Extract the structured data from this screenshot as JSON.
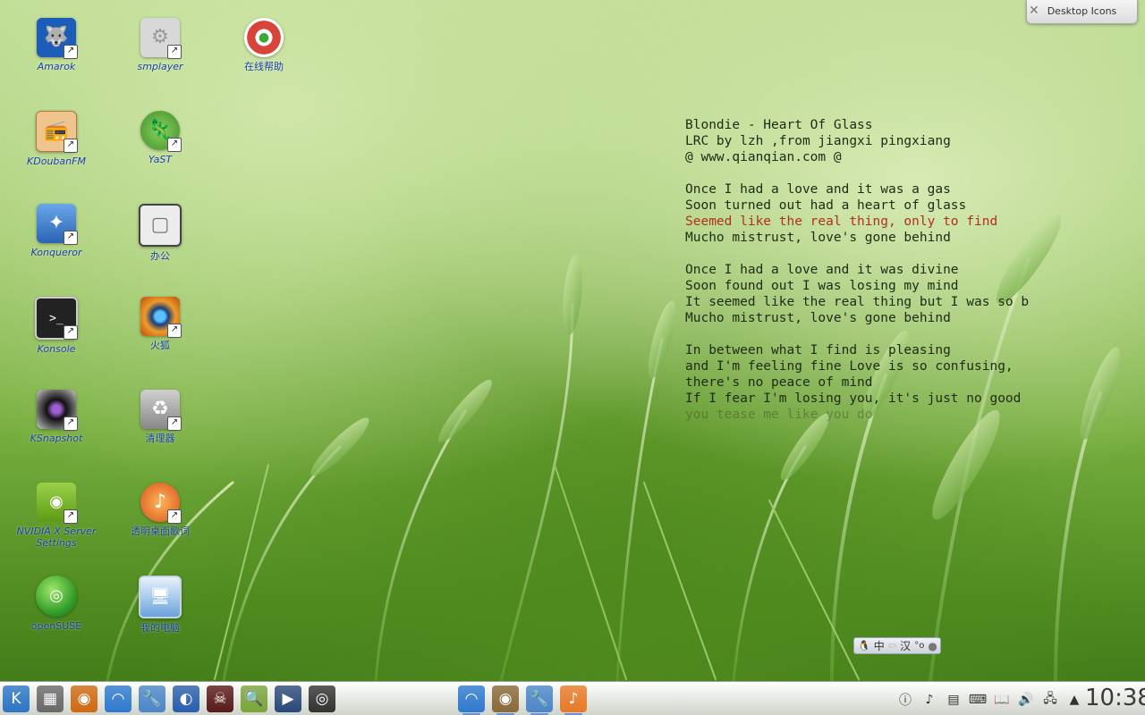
{
  "desktop": {
    "icons": [
      {
        "label": "Amarok",
        "glyph": "🐺",
        "icon": "amarok-icon",
        "bg": "#1b5db8"
      },
      {
        "label": "smplayer",
        "glyph": "⚙",
        "icon": "smplayer-icon",
        "bg": "#d8d8d8"
      },
      {
        "label": "在线帮助",
        "glyph": "🛟",
        "icon": "help-lifebuoy-icon",
        "bg": "#d8443a"
      },
      {
        "label": "KDoubanFM",
        "glyph": "📻",
        "icon": "radio-icon",
        "bg": "#e9b57a"
      },
      {
        "label": "YaST",
        "glyph": "🦎",
        "icon": "yast-icon",
        "bg": "#5aa83a"
      },
      {
        "label": "Konqueror",
        "glyph": "✦",
        "icon": "compass-icon",
        "bg": "#3d79c9"
      },
      {
        "label": "办公",
        "glyph": "▢",
        "icon": "document-icon",
        "bg": "#e8e8e8"
      },
      {
        "label": "Konsole",
        "glyph": ">_",
        "icon": "terminal-icon",
        "bg": "#2a2a2a"
      },
      {
        "label": "火狐",
        "glyph": "◉",
        "icon": "firefox-eye-icon",
        "bg": "#d06a12"
      },
      {
        "label": "KSnapshot",
        "glyph": "◎",
        "icon": "camera-lens-icon",
        "bg": "#3a3a3a"
      },
      {
        "label": "清理器",
        "glyph": "♻",
        "icon": "trash-bin-icon",
        "bg": "#8e8e8e"
      },
      {
        "label": "NVIDIA X Server Settings",
        "glyph": "◉",
        "icon": "nvidia-eye-icon",
        "bg": "#7ab51d"
      },
      {
        "label": "透明桌面歌词",
        "glyph": "♪",
        "icon": "lyrics-icon",
        "bg": "#e87a28"
      },
      {
        "label": "openSUSE",
        "glyph": "◎",
        "icon": "opensuse-icon",
        "bg": "#3aa836"
      },
      {
        "label": "我的电脑",
        "glyph": "🖥",
        "icon": "computer-icon",
        "bg": "#4a8cd1"
      }
    ]
  },
  "lyrics": {
    "lines": [
      "Blondie - Heart Of Glass",
      "LRC by lzh ,from jiangxi pingxiang",
      "@ www.qianqian.com @",
      "",
      "Once I had a love and it was a gas",
      "Soon turned out had a heart of glass",
      "Seemed like the real thing, only to find",
      "Mucho mistrust, love's gone behind",
      "",
      "Once I had a love and it was divine",
      "Soon found out I was losing my mind",
      "It seemed like the real thing but I was so b",
      "Mucho mistrust, love's gone behind",
      "",
      "In between what I find is pleasing",
      "and I'm feeling fine Love is so confusing,",
      "there's no peace of mind",
      "If I fear I'm losing you, it's just no good",
      "you tease me like you do"
    ],
    "current_index": 6,
    "current_color": "#b0301c"
  },
  "widget": {
    "title": "Desktop Icons",
    "close": "✕"
  },
  "ime": {
    "mode": "中",
    "charset": "汉",
    "extra": "°o"
  },
  "taskbar": {
    "launchers": [
      {
        "name": "kde-menu-icon",
        "glyph": "K",
        "bg": "#2c76c7"
      },
      {
        "name": "apps-grid-icon",
        "glyph": "▦",
        "bg": "#6a6a6a"
      },
      {
        "name": "firefox-eye-icon",
        "glyph": "◉",
        "bg": "#d06a12"
      },
      {
        "name": "dolphin-icon",
        "glyph": "◠",
        "bg": "#2f7ad0"
      },
      {
        "name": "tools-icon",
        "glyph": "🔧",
        "bg": "#4d86c9"
      },
      {
        "name": "amarok-icon",
        "glyph": "◐",
        "bg": "#2a5fae"
      },
      {
        "name": "skull-icon",
        "glyph": "☠",
        "bg": "#5a1a1a"
      },
      {
        "name": "magnifier-icon",
        "glyph": "🔍",
        "bg": "#7aa63a"
      },
      {
        "name": "video-player-icon",
        "glyph": "▶",
        "bg": "#2b4a7a"
      },
      {
        "name": "camera-lens-icon",
        "glyph": "◎",
        "bg": "#333333"
      }
    ],
    "tasks": [
      {
        "name": "dolphin-task-icon",
        "glyph": "◠",
        "bg": "#2f7ad0"
      },
      {
        "name": "speaker-task-icon",
        "glyph": "◉",
        "bg": "#8a6a3a"
      },
      {
        "name": "tools-task-icon",
        "glyph": "🔧",
        "bg": "#4d86c9"
      },
      {
        "name": "lyrics-task-icon",
        "glyph": "♪",
        "bg": "#e87a28"
      }
    ],
    "tray": [
      {
        "name": "info-icon",
        "glyph": "ⓘ"
      },
      {
        "name": "lyrics-tray-icon",
        "glyph": "♪"
      },
      {
        "name": "clipboard-icon",
        "glyph": "▤"
      },
      {
        "name": "keyboard-icon",
        "glyph": "⌨"
      },
      {
        "name": "dictionary-icon",
        "glyph": "📖"
      },
      {
        "name": "volume-icon",
        "glyph": "🔊"
      },
      {
        "name": "network-icon",
        "glyph": "🖧"
      },
      {
        "name": "tray-expand-icon",
        "glyph": "▲"
      }
    ],
    "clock": "10:38"
  }
}
